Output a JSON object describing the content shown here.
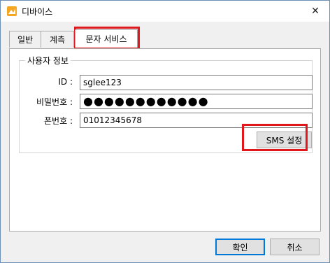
{
  "window": {
    "title": "디바이스",
    "close_glyph": "✕"
  },
  "tabs": [
    {
      "label": "일반",
      "active": false
    },
    {
      "label": "계측",
      "active": false
    },
    {
      "label": "문자 서비스",
      "active": true
    }
  ],
  "group": {
    "title": "사용자 정보",
    "id_label": "ID :",
    "id_value": "sglee123",
    "password_label": "비밀번호 :",
    "password_value": "●●●●●●●●●●●●",
    "phone_label": "폰번호 :",
    "phone_value": "01012345678",
    "sms_button": "SMS 설정"
  },
  "footer": {
    "ok": "확인",
    "cancel": "취소"
  },
  "colors": {
    "highlight": "#e0181b",
    "focus": "#0078d7"
  },
  "icons": {
    "app": "device-app-icon",
    "close": "close-icon"
  }
}
